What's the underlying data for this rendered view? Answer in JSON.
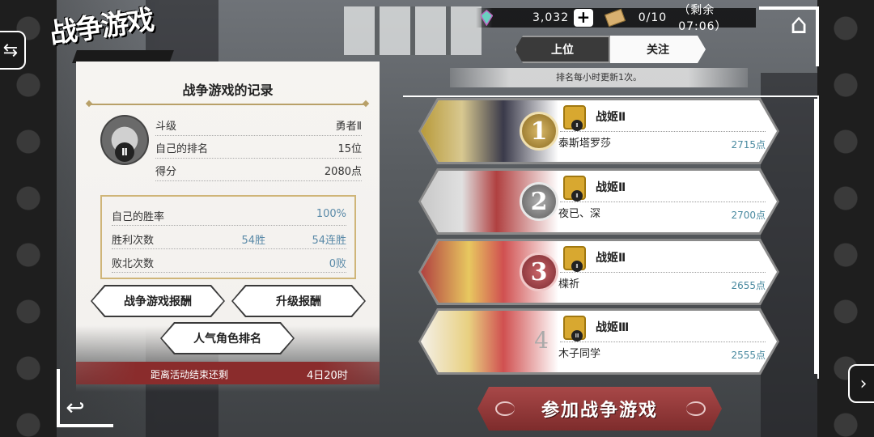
{
  "page_title": "战争游戏",
  "status": {
    "gems": "3,032",
    "tickets": "0/10",
    "remaining": "（剩余07:06）"
  },
  "icons": {
    "gem": "gem-icon",
    "plus": "plus-icon",
    "ticket": "ticket-icon",
    "home": "home-icon",
    "swap": "swap-arrows-icon",
    "back": "back-arrow-icon",
    "next": "next-icon"
  },
  "record": {
    "title": "战争游戏的记录",
    "stats": [
      {
        "label": "斗级",
        "value": "勇者Ⅱ"
      },
      {
        "label": "自己的排名",
        "value": "15位"
      },
      {
        "label": "得分",
        "value": "2080点"
      }
    ],
    "rank_emblem_level": "Ⅱ",
    "win_rate": {
      "label": "自己的胜率",
      "value": "100%"
    },
    "wins": {
      "label": "胜利次数",
      "value": "54胜",
      "streak": "54连胜"
    },
    "losses": {
      "label": "败北次数",
      "value": "0败"
    }
  },
  "buttons": {
    "rewards": "战争游戏报酬",
    "upgrade_rewards": "升级报酬",
    "popular_ranking": "人气角色排名",
    "join": "参加战争游戏"
  },
  "event": {
    "label": "距离活动结束还剩",
    "value": "4日20时"
  },
  "tabs": {
    "top": "上位",
    "follow": "关注"
  },
  "update_note": "排名每小时更新1次。",
  "ranking": [
    {
      "rank": "1",
      "class": "战姬Ⅱ",
      "badge": "Ⅱ",
      "player": "泰斯塔罗莎",
      "points": "2715点"
    },
    {
      "rank": "2",
      "class": "战姬Ⅱ",
      "badge": "Ⅱ",
      "player": "夜已、深",
      "points": "2700点"
    },
    {
      "rank": "3",
      "class": "战姬Ⅱ",
      "badge": "Ⅱ",
      "player": "楪祈",
      "points": "2655点"
    },
    {
      "rank": "4",
      "class": "战姬Ⅲ",
      "badge": "Ⅲ",
      "player": "木子同学",
      "points": "2555点"
    }
  ],
  "colors": {
    "accent_gold": "#cfb578",
    "join_red": "#a84848",
    "value_blue": "#4a8aa0",
    "medal_gold": "#b8964a",
    "medal_silver": "#8a8a8a",
    "medal_bronze": "#a8444a"
  }
}
